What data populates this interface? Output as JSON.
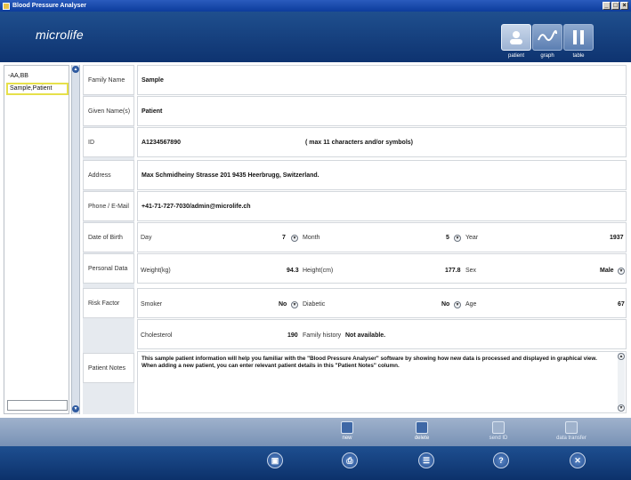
{
  "window": {
    "title": "Blood Pressure Analyser"
  },
  "header": {
    "logo": "microlife",
    "tabs": [
      {
        "label": "patient",
        "icon": "patient-icon",
        "active": true
      },
      {
        "label": "graph",
        "icon": "graph-icon",
        "active": false
      },
      {
        "label": "table",
        "icon": "table-icon",
        "active": false
      }
    ]
  },
  "patient_list": {
    "items": [
      "-AA,BB",
      "Sample,Patient"
    ],
    "selected_index": 1,
    "search_value": ""
  },
  "form": {
    "family_name": {
      "label": "Family Name",
      "value": "Sample"
    },
    "given_names": {
      "label": "Given Name(s)",
      "value": "Patient"
    },
    "id": {
      "label": "ID",
      "value": "A1234567890",
      "hint": "( max 11 characters and/or symbols)"
    },
    "address": {
      "label": "Address",
      "value": "Max Schmidheiny Strasse 201 9435 Heerbrugg, Switzerland."
    },
    "phone_email": {
      "label": "Phone / E-Mail",
      "value": "+41-71-727-7030/admin@microlife.ch"
    },
    "date_of_birth": {
      "label": "Date of Birth",
      "day_label": "Day",
      "day": "7",
      "month_label": "Month",
      "month": "5",
      "year_label": "Year",
      "year": "1937"
    },
    "personal_data": {
      "label": "Personal Data",
      "weight_label": "Weight(kg)",
      "weight": "94.3",
      "height_label": "Height(cm)",
      "height": "177.8",
      "sex_label": "Sex",
      "sex": "Male"
    },
    "risk_factor": {
      "label": "Risk Factor",
      "smoker_label": "Smoker",
      "smoker": "No",
      "diabetic_label": "Diabetic",
      "diabetic": "No",
      "age_label": "Age",
      "age": "67",
      "cholesterol_label": "Cholesterol",
      "cholesterol": "190",
      "family_history_label": "Family history",
      "family_history": "Not available."
    },
    "notes": {
      "label": "Patient Notes",
      "value": "This sample patient information will help you familiar with the \"Blood Pressure Analyser\" software by showing how new data is processed and displayed in graphical view. When adding a new patient, you can enter relevant patient details in this \"Patient Notes\" column."
    }
  },
  "actions": [
    {
      "label": "new",
      "enabled": true
    },
    {
      "label": "delete",
      "enabled": true
    },
    {
      "label": "send ID",
      "enabled": false
    },
    {
      "label": "data transfer",
      "enabled": false
    }
  ],
  "bottom_buttons": [
    {
      "icon": "save-icon",
      "glyph": "▣"
    },
    {
      "icon": "print-icon",
      "glyph": "⎙"
    },
    {
      "icon": "list-icon",
      "glyph": "☰"
    },
    {
      "icon": "help-icon",
      "glyph": "?"
    },
    {
      "icon": "close-icon",
      "glyph": "✕"
    }
  ]
}
